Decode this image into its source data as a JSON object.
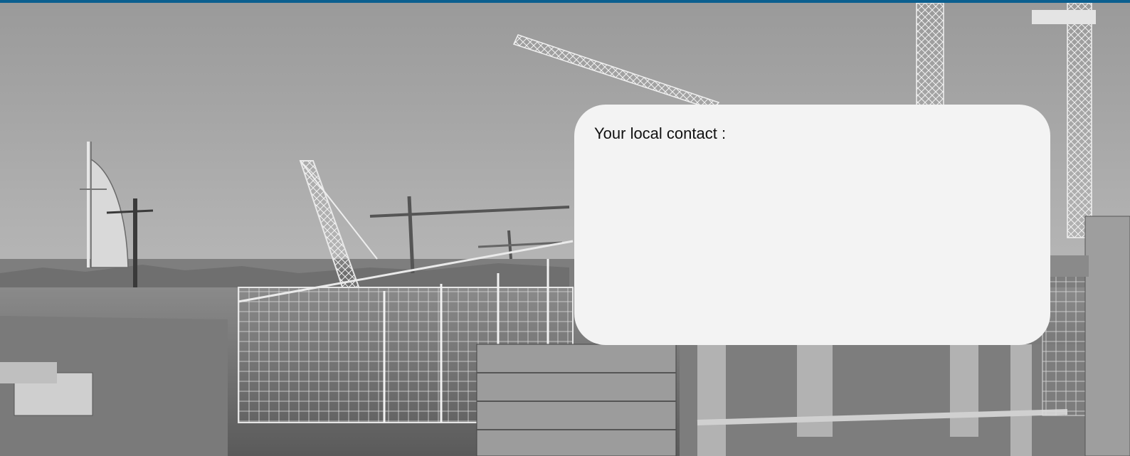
{
  "contact_card": {
    "label": "Your local contact :"
  },
  "hero": {
    "icon": "construction-site-photo",
    "tone": "grayscale"
  },
  "colors": {
    "top_bar": "#0b5f8f",
    "card_background": "#f3f3f3",
    "text": "#111111"
  }
}
